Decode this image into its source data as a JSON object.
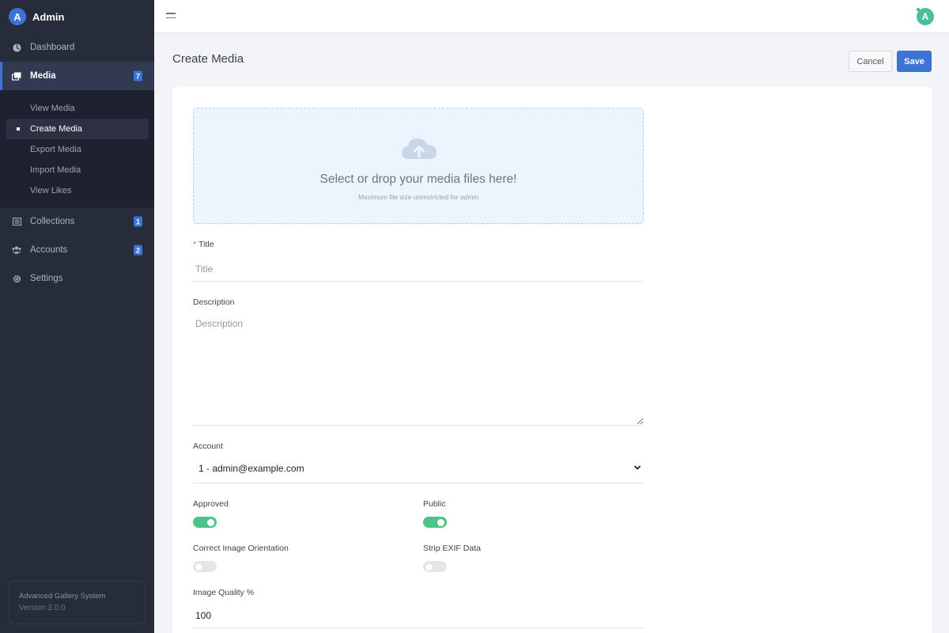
{
  "brand": {
    "initial": "A",
    "name": "Admin"
  },
  "sidebar": {
    "items": [
      {
        "label": "Dashboard",
        "icon": "dashboard-icon"
      },
      {
        "label": "Media",
        "icon": "media-icon",
        "count": "7"
      },
      {
        "label": "Collections",
        "icon": "collections-icon",
        "count": "1"
      },
      {
        "label": "Accounts",
        "icon": "accounts-icon",
        "count": "2"
      },
      {
        "label": "Settings",
        "icon": "gear-icon"
      }
    ],
    "media_submenu": [
      "View Media",
      "Create Media",
      "Export Media",
      "Import Media",
      "View Likes"
    ],
    "footer": {
      "title": "Advanced Gallery System",
      "version": "Version 3.0.0"
    }
  },
  "topbar": {
    "avatar_initial": "A"
  },
  "page": {
    "title": "Create Media",
    "cancel_label": "Cancel",
    "save_label": "Save"
  },
  "dropzone": {
    "title": "Select or drop your media files here!",
    "subtitle": "Maximum file size unrestricted for admin"
  },
  "form": {
    "title_required_mark": "*",
    "title_label": "Title",
    "title_placeholder": "Title",
    "description_label": "Description",
    "description_placeholder": "Description",
    "account_label": "Account",
    "account_value": "1 - admin@example.com",
    "approved_label": "Approved",
    "approved": true,
    "public_label": "Public",
    "public": true,
    "orientation_label": "Correct Image Orientation",
    "orientation": false,
    "exif_label": "Strip EXIF Data",
    "exif": false,
    "quality_label": "Image Quality %",
    "quality_value": "100"
  },
  "colors": {
    "accent": "#3d72d6",
    "sidebar": "#272c3b",
    "toggle_on": "#4cc489"
  }
}
